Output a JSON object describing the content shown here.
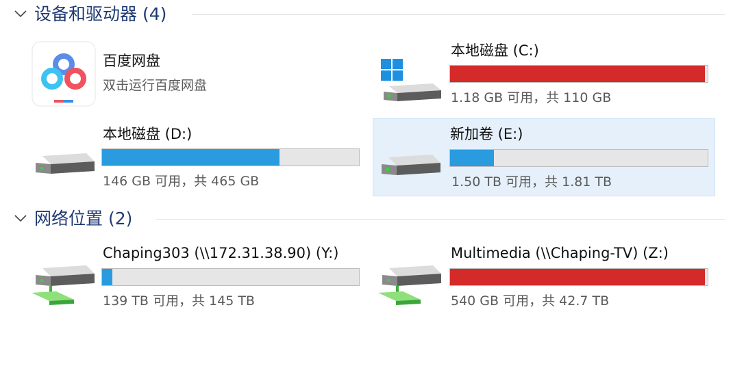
{
  "groups": [
    {
      "title": "设备和驱动器 (4)"
    },
    {
      "title": "网络位置 (2)"
    }
  ],
  "app": {
    "name": "百度网盘",
    "description": "双击运行百度网盘",
    "icon": "baidu-netdisk-icon"
  },
  "drives": [
    {
      "name": "本地磁盘 (C:)",
      "usage": "1.18 GB 可用，共 110 GB",
      "used_fraction": 0.99,
      "bar_color": "#d42a2a",
      "icon": "windows-system-drive-icon"
    },
    {
      "name": "本地磁盘 (D:)",
      "usage": "146 GB 可用，共 465 GB",
      "used_fraction": 0.69,
      "bar_color": "#2b9be0",
      "icon": "hard-drive-icon"
    },
    {
      "name": "新加卷 (E:)",
      "usage": "1.50 TB 可用，共 1.81 TB",
      "used_fraction": 0.17,
      "bar_color": "#2b9be0",
      "icon": "hard-drive-icon"
    }
  ],
  "network": [
    {
      "name": "Chaping303 (\\\\172.31.38.90) (Y:)",
      "usage": "139 TB 可用，共 145 TB",
      "used_fraction": 0.04,
      "bar_color": "#2b9be0",
      "icon": "network-drive-icon"
    },
    {
      "name": "Multimedia (\\\\Chaping-TV) (Z:)",
      "usage": "540 GB 可用，共 42.7 TB",
      "used_fraction": 0.99,
      "bar_color": "#d42a2a",
      "icon": "network-drive-icon"
    }
  ],
  "colors": {
    "header_text": "#1f3a73",
    "selected_bg": "#e5f0fb",
    "bar_bg": "#e6e6e6"
  }
}
